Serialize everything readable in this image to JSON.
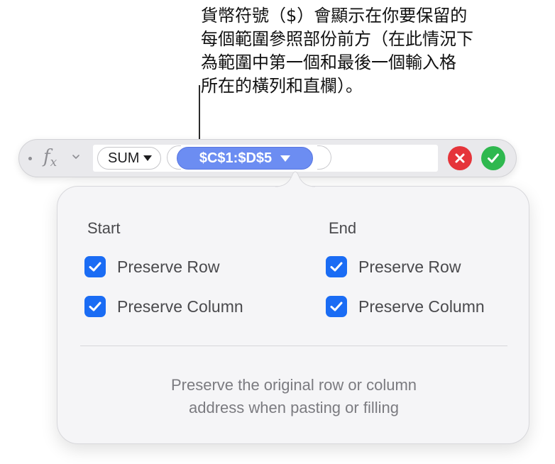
{
  "callout": {
    "lines": [
      "貨幣符號（$）會顯示在你要保留的",
      "每個範圍參照部份前方（在此情況下",
      "為範圍中第一個和最後一個輸入格",
      "所在的橫列和直欄）。"
    ]
  },
  "formula_bar": {
    "fx_label": "f",
    "fx_sub": "x",
    "function_token": "SUM",
    "reference_token": "$C$1:$D$5"
  },
  "popover": {
    "start": {
      "heading": "Start",
      "preserve_row": {
        "label": "Preserve Row",
        "checked": true
      },
      "preserve_column": {
        "label": "Preserve Column",
        "checked": true
      }
    },
    "end": {
      "heading": "End",
      "preserve_row": {
        "label": "Preserve Row",
        "checked": true
      },
      "preserve_column": {
        "label": "Preserve Column",
        "checked": true
      }
    },
    "description": {
      "line1": "Preserve the original row or column",
      "line2": "address when pasting or filling"
    }
  },
  "colors": {
    "accent_blue": "#1a6cf4",
    "reference_token": "#6c8df2",
    "cancel_red": "#e5343a",
    "accept_green": "#2fb84f"
  }
}
